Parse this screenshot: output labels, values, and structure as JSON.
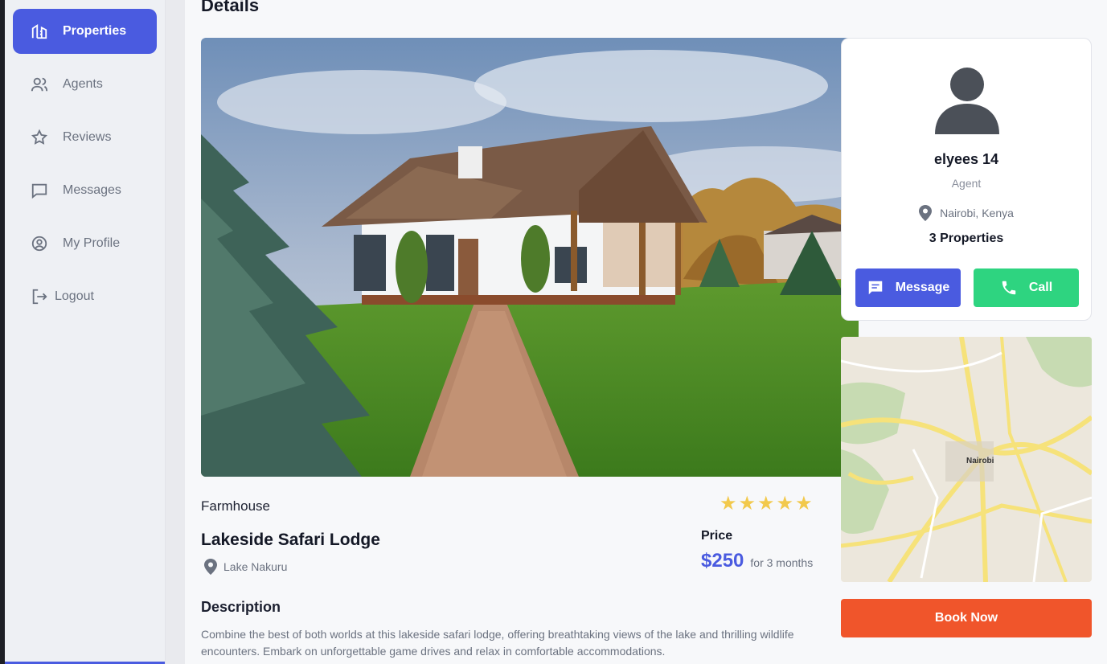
{
  "sidebar": {
    "items": [
      {
        "label": "Properties",
        "icon": "building-icon",
        "active": true
      },
      {
        "label": "Agents",
        "icon": "users-icon",
        "active": false
      },
      {
        "label": "Reviews",
        "icon": "star-icon",
        "active": false
      },
      {
        "label": "Messages",
        "icon": "message-icon",
        "active": false
      },
      {
        "label": "My Profile",
        "icon": "user-circle-icon",
        "active": false
      },
      {
        "label": "Logout",
        "icon": "logout-icon",
        "active": false
      }
    ]
  },
  "page": {
    "title": "Details"
  },
  "property": {
    "category": "Farmhouse",
    "rating": 5,
    "name": "Lakeside Safari Lodge",
    "location": "Lake Nakuru",
    "price_label": "Price",
    "price": "$250",
    "price_period": "for 3 months",
    "description_heading": "Description",
    "description": "Combine the best of both worlds at this lakeside safari lodge, offering breathtaking views of the lake and thrilling wildlife encounters. Embark on unforgettable game drives and relax in comfortable accommodations."
  },
  "agent": {
    "name": "elyees 14",
    "role": "Agent",
    "location": "Nairobi, Kenya",
    "properties": "3 Properties",
    "message_label": "Message",
    "call_label": "Call"
  },
  "map": {
    "center_label": "Nairobi"
  },
  "actions": {
    "book_label": "Book Now"
  },
  "colors": {
    "primary": "#4a5be0",
    "success": "#2ed480",
    "accent": "#f0552b",
    "star": "#f2c94c"
  }
}
